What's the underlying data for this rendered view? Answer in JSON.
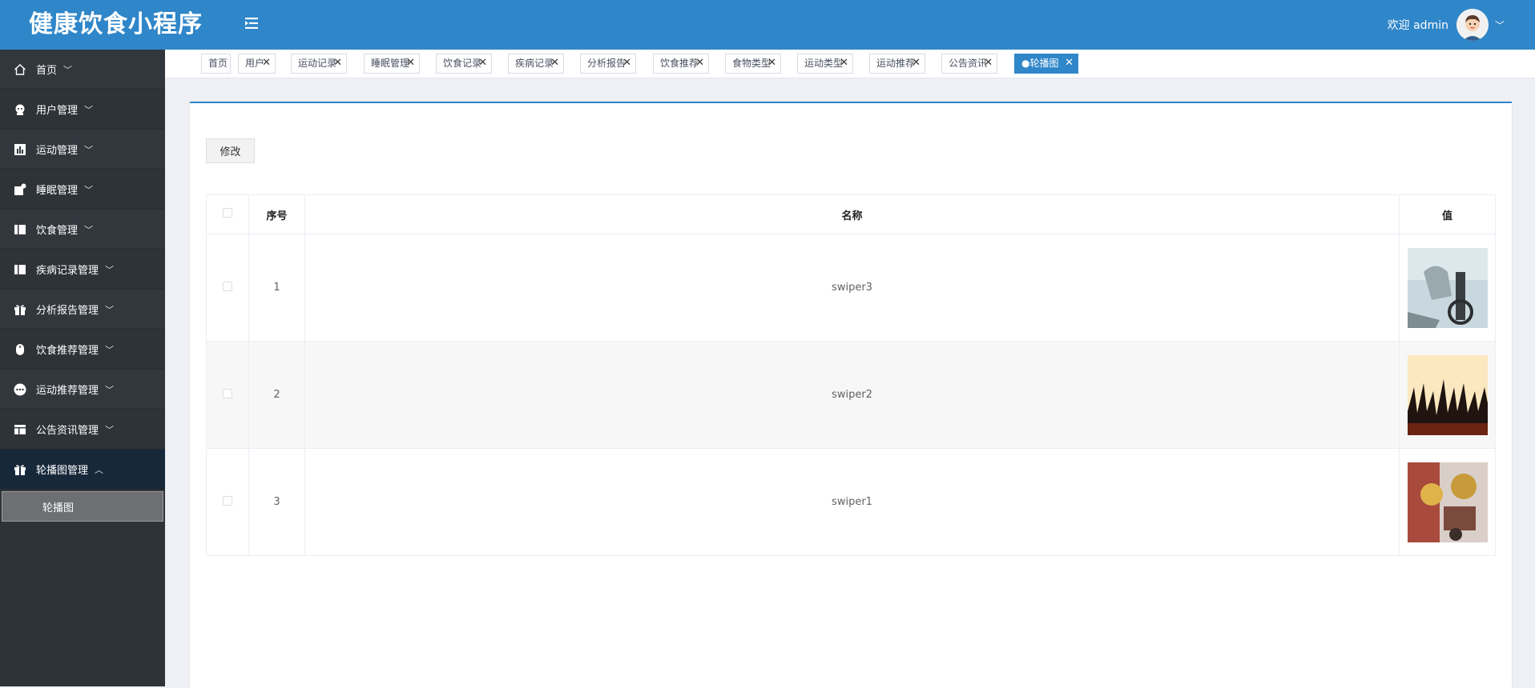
{
  "app": {
    "title": "健康饮食小程序"
  },
  "user": {
    "welcome": "欢迎 admin"
  },
  "sidebar": {
    "items": [
      {
        "label": "首页",
        "icon": "home-icon"
      },
      {
        "label": "用户管理",
        "icon": "user-icon"
      },
      {
        "label": "运动管理",
        "icon": "chart-icon"
      },
      {
        "label": "睡眠管理",
        "icon": "sleep-icon"
      },
      {
        "label": "饮食管理",
        "icon": "book-icon"
      },
      {
        "label": "疾病记录管理",
        "icon": "book-icon"
      },
      {
        "label": "分析报告管理",
        "icon": "gift-icon"
      },
      {
        "label": "饮食推荐管理",
        "icon": "mouse-icon"
      },
      {
        "label": "运动推荐管理",
        "icon": "more-icon"
      },
      {
        "label": "公告资讯管理",
        "icon": "layout-icon"
      },
      {
        "label": "轮播图管理",
        "icon": "gift-icon"
      }
    ],
    "submenu": {
      "label": "轮播图"
    }
  },
  "tabs": [
    {
      "label": "首页"
    },
    {
      "label": "用户"
    },
    {
      "label": "运动记录"
    },
    {
      "label": "睡眠管理"
    },
    {
      "label": "饮食记录"
    },
    {
      "label": "疾病记录"
    },
    {
      "label": "分析报告"
    },
    {
      "label": "饮食推荐"
    },
    {
      "label": "食物类型"
    },
    {
      "label": "运动类型"
    },
    {
      "label": "运动推荐"
    },
    {
      "label": "公告资讯"
    },
    {
      "label": "●轮播图"
    }
  ],
  "toolbar": {
    "edit_label": "修改"
  },
  "table": {
    "headers": {
      "index": "序号",
      "name": "名称",
      "value": "值"
    },
    "rows": [
      {
        "index": "1",
        "name": "swiper3"
      },
      {
        "index": "2",
        "name": "swiper2"
      },
      {
        "index": "3",
        "name": "swiper1"
      }
    ]
  },
  "colors": {
    "primary": "#2f86c9",
    "sidebar": "#2e3338",
    "sidebar_active": "#17283a"
  }
}
